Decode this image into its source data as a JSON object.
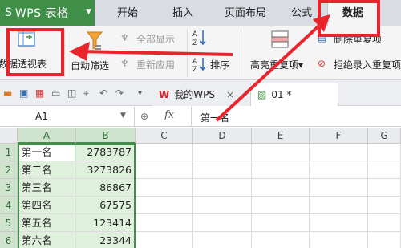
{
  "menubar": {
    "brand": "WPS 表格",
    "brand_arrow": "S",
    "tabs": [
      "开始",
      "插入",
      "页面布局",
      "公式",
      "数据"
    ],
    "active_tab": "数据"
  },
  "ribbon": {
    "pivot_table": "数据透视表",
    "auto_filter": "自动筛选",
    "show_all": "全部显示",
    "reapply": "重新应用",
    "sort": "排序",
    "highlight_dup": "高亮重复项",
    "highlight_dup_caret": "▾",
    "remove_dup": "删除重复项",
    "reject_dup": "拒绝录入重复项"
  },
  "doctabs": {
    "home_label": "我的WPS",
    "file_label": "01 *",
    "close": "×",
    "dropdown": "▾"
  },
  "formula_bar": {
    "cell_ref": "A1",
    "fx": "fx",
    "zoom": "⊕",
    "value": "第一名"
  },
  "grid": {
    "columns": [
      "A",
      "B",
      "C",
      "D",
      "E",
      "F",
      "G"
    ],
    "rows": [
      {
        "num": "1",
        "a": "第一名",
        "b": "2783787"
      },
      {
        "num": "2",
        "a": "第二名",
        "b": "3273826"
      },
      {
        "num": "3",
        "a": "第三名",
        "b": "86867"
      },
      {
        "num": "4",
        "a": "第四名",
        "b": "67575"
      },
      {
        "num": "5",
        "a": "第五名",
        "b": "123414"
      },
      {
        "num": "6",
        "a": "第六名",
        "b": "23344"
      }
    ]
  },
  "colors": {
    "brand_green": "#3f8f48",
    "highlight_red": "#e8252c",
    "selection_fill": "#dff0dc"
  }
}
